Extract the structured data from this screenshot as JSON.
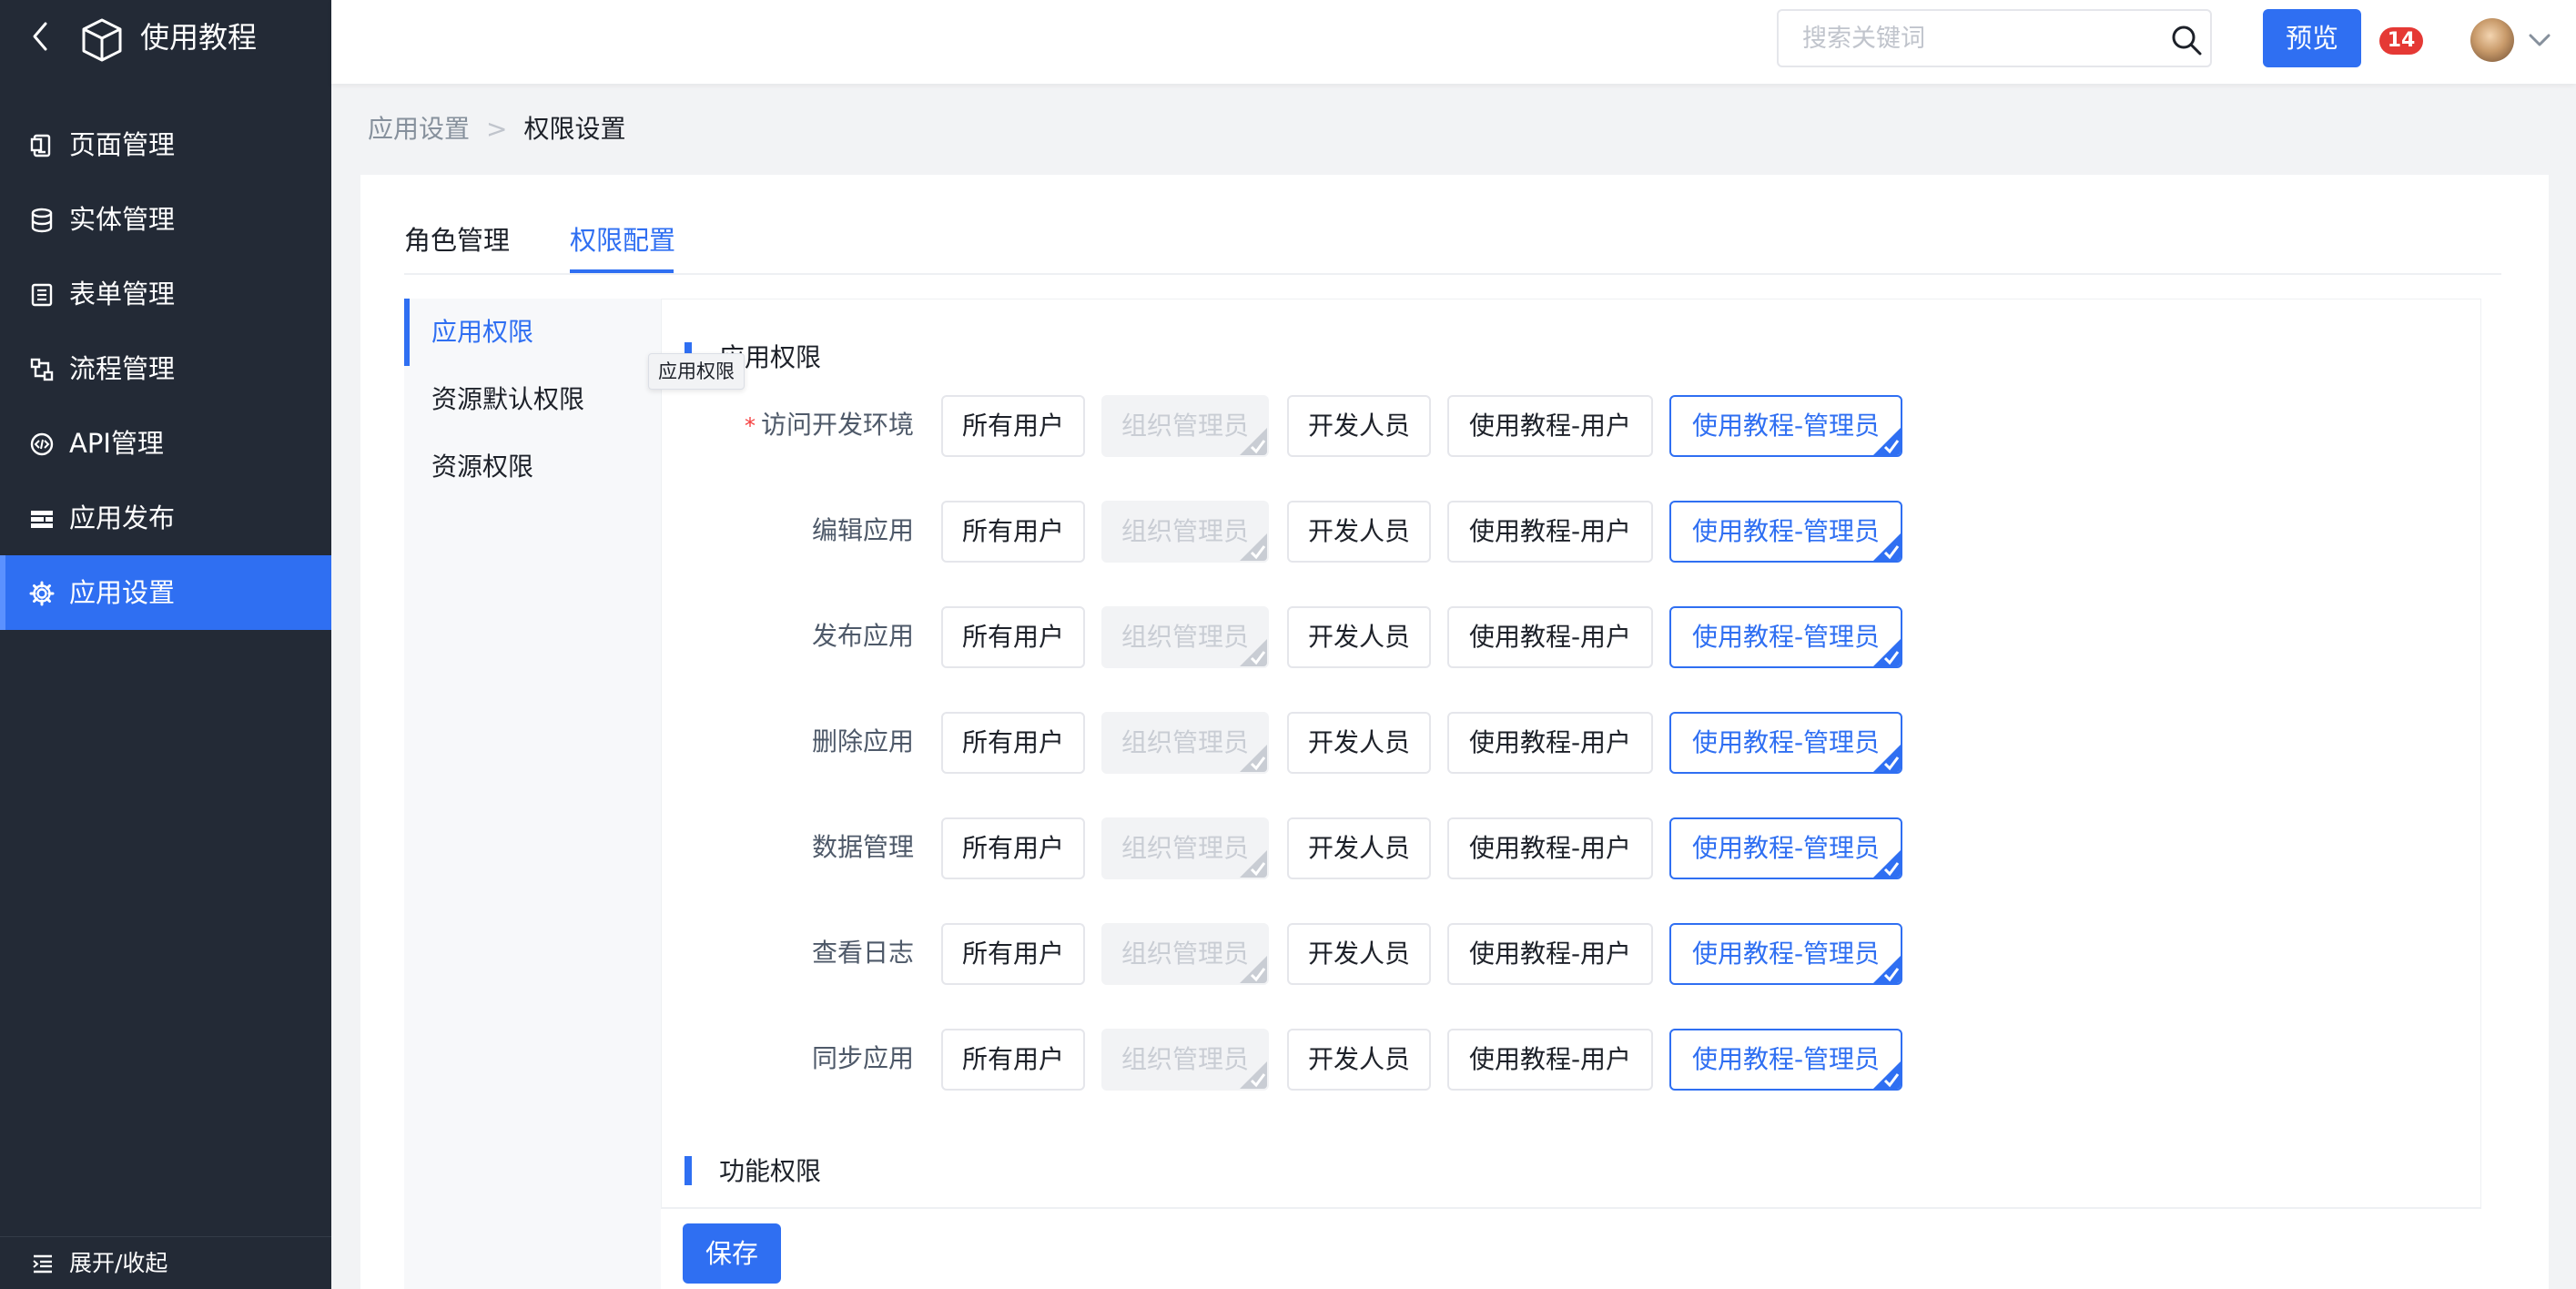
{
  "app": {
    "title": "使用教程"
  },
  "sidebar": {
    "items": [
      {
        "label": "页面管理",
        "icon": "page-icon"
      },
      {
        "label": "实体管理",
        "icon": "database-icon"
      },
      {
        "label": "表单管理",
        "icon": "form-icon"
      },
      {
        "label": "流程管理",
        "icon": "flow-icon"
      },
      {
        "label": "API管理",
        "icon": "api-icon"
      },
      {
        "label": "应用发布",
        "icon": "publish-icon"
      },
      {
        "label": "应用设置",
        "icon": "gear-icon",
        "active": true
      }
    ],
    "collapse_label": "展开/收起"
  },
  "header": {
    "search_placeholder": "搜索关键词",
    "preview_label": "预览",
    "notification_count": "14"
  },
  "breadcrumb": {
    "parent": "应用设置",
    "separator": ">",
    "current": "权限设置"
  },
  "tabs": [
    {
      "label": "角色管理"
    },
    {
      "label": "权限配置",
      "active": true
    }
  ],
  "subnav": [
    {
      "label": "应用权限",
      "active": true
    },
    {
      "label": "资源默认权限"
    },
    {
      "label": "资源权限"
    }
  ],
  "tooltip": "应用权限",
  "sections": {
    "app_permissions": "应用权限",
    "feature_permissions": "功能权限"
  },
  "options": [
    "所有用户",
    "组织管理员",
    "开发人员",
    "使用教程-用户",
    "使用教程-管理员"
  ],
  "rows": [
    {
      "label": "访问开发环境",
      "required": true
    },
    {
      "label": "编辑应用"
    },
    {
      "label": "发布应用"
    },
    {
      "label": "删除应用"
    },
    {
      "label": "数据管理"
    },
    {
      "label": "查看日志"
    },
    {
      "label": "同步应用"
    }
  ],
  "row_option_states": [
    "unchecked",
    "disabled-checked",
    "unchecked",
    "unchecked",
    "checked"
  ],
  "save_label": "保存",
  "colors": {
    "primary": "#2f6ff2",
    "sidebar_bg": "#232a36",
    "badge": "#e53935",
    "required": "#f53f3f"
  }
}
